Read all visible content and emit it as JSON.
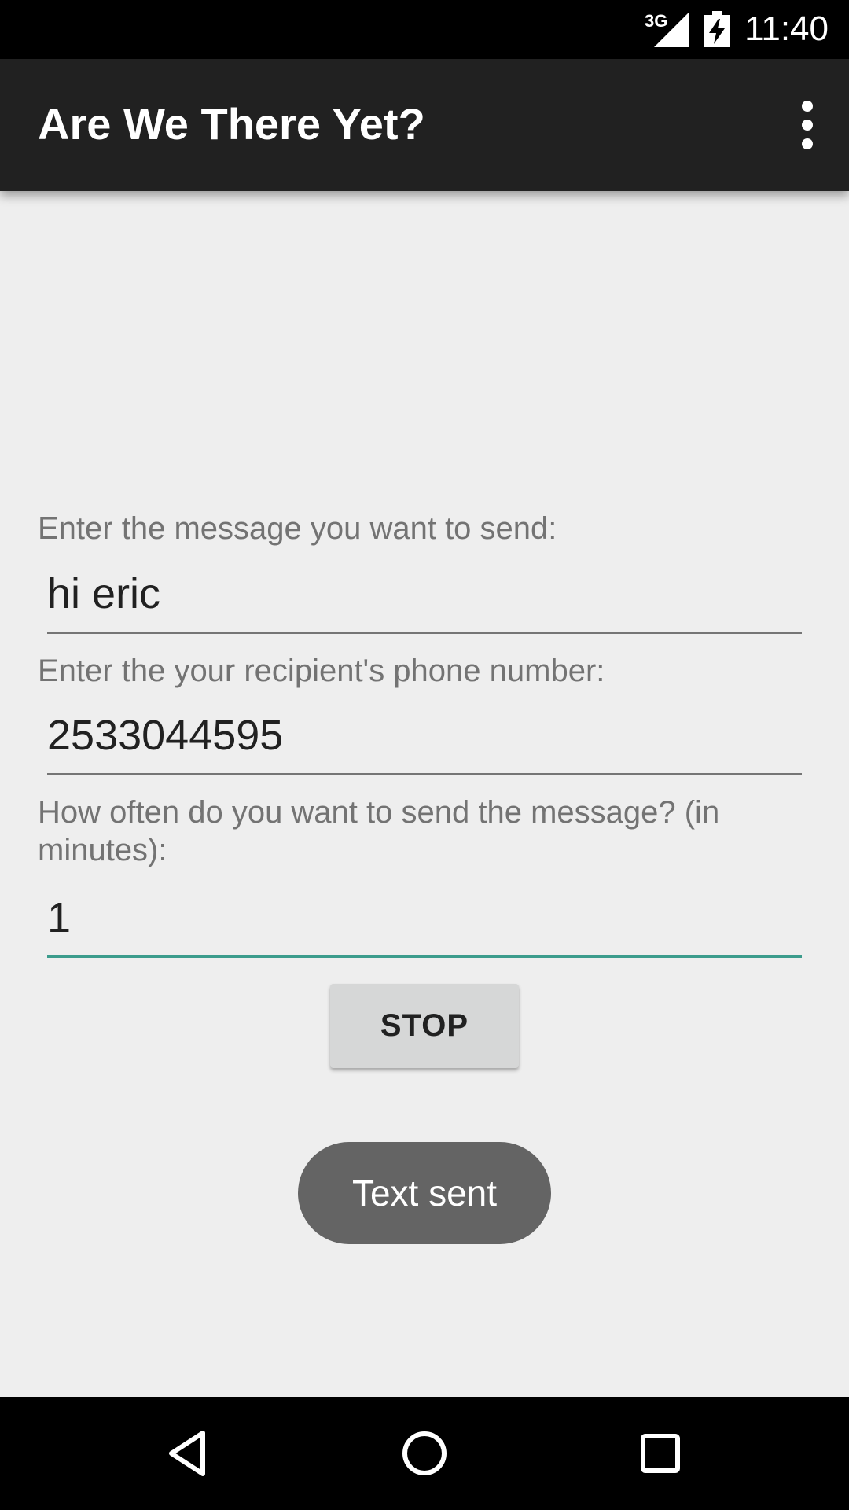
{
  "status_bar": {
    "network": "3G",
    "time": "11:40",
    "icons": [
      "signal-icon",
      "battery-charging-icon"
    ]
  },
  "app_bar": {
    "title": "Are We There Yet?",
    "overflow_icon": "more-vert-icon"
  },
  "form": {
    "message_label": "Enter the message you want to send:",
    "message_value": "hi eric",
    "phone_label": "Enter the your recipient's phone number:",
    "phone_value": "2533044595",
    "interval_label": "How often do you want to send the message? (in minutes):",
    "interval_value": "1",
    "stop_label": "STOP"
  },
  "toast": {
    "text": "Text sent"
  },
  "nav_bar": {
    "icons": [
      "back-icon",
      "home-icon",
      "recents-icon"
    ]
  },
  "colors": {
    "app_bar": "#212121",
    "background": "#eeeeee",
    "focus_accent": "#3c9c8c",
    "button": "#d6d7d7",
    "toast": "#646464"
  }
}
